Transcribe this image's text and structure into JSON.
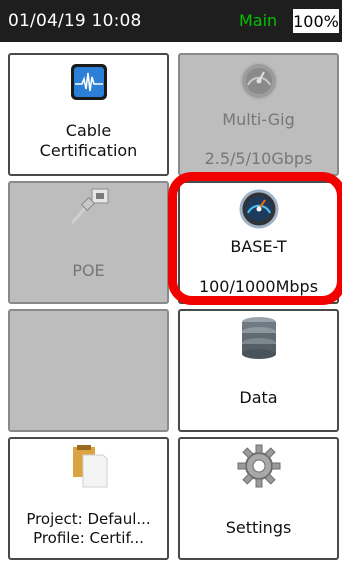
{
  "status": {
    "datetime": "01/04/19 10:08",
    "mode": "Main",
    "battery": "100%"
  },
  "tiles": {
    "cable_certification": {
      "line1": "Cable",
      "line2": "Certification"
    },
    "multi_gig": {
      "line1": "Multi-Gig",
      "line2": "2.5/5/10Gbps"
    },
    "poe": {
      "label": "POE"
    },
    "base_t": {
      "line1": "BASE-T",
      "line2": "100/1000Mbps"
    },
    "data": {
      "label": "Data"
    },
    "project": {
      "line1": "Project: Defaul...",
      "line2": "Profile: Certif..."
    },
    "settings": {
      "label": "Settings"
    }
  },
  "icons": [
    "waveform-icon",
    "gauge-icon",
    "poe-plug-icon",
    "database-icon",
    "clipboard-icon",
    "gear-icon"
  ],
  "colors": {
    "highlight": "#f20000",
    "status_bar": "#1e1e1e",
    "main_mode": "#00c000"
  }
}
